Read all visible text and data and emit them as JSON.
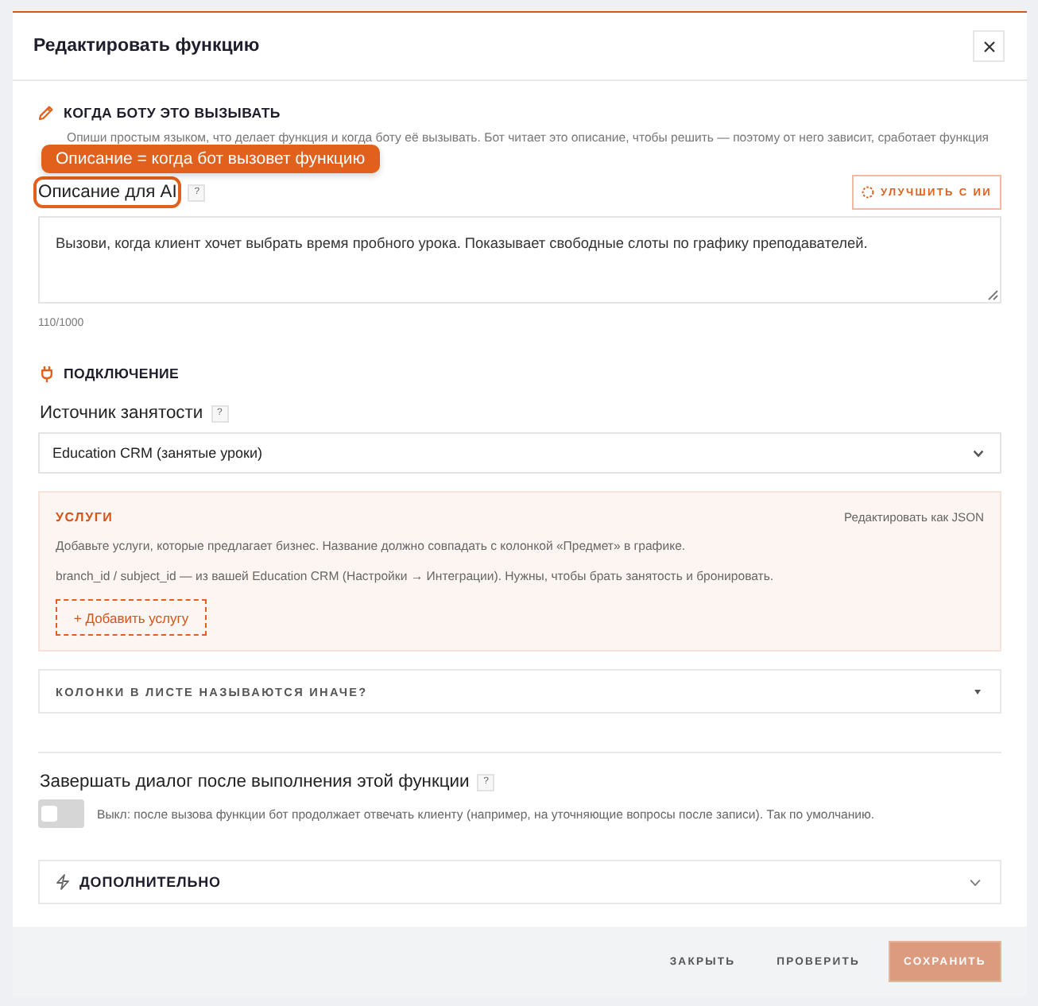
{
  "dialog": {
    "title": "Редактировать функцию"
  },
  "trigger": {
    "heading": "КОГДА БОТУ ЭТО ВЫЗЫВАТЬ",
    "hint": "Опиши простым языком, что делает функция и когда боту её вызывать. Бот читает это описание, чтобы решить — поэтому от него зависит, сработает функция",
    "callout": "Описание = когда бот вызовет функцию",
    "label": "Описание для AI",
    "highlighted": true,
    "help": "?",
    "improve_button": "УЛУЧШИТЬ С ИИ",
    "value": "Вызови, когда клиент хочет выбрать время пробного урока. Показывает свободные слоты по графику преподавателей.",
    "counter": "110/1000"
  },
  "connection": {
    "heading": "ПОДКЛЮЧЕНИЕ",
    "source_label": "Источник занятости",
    "source_help": "?",
    "source_value": "Education CRM (занятые уроки)",
    "services": {
      "title": "УСЛУГИ",
      "edit_json_link": "Редактировать как JSON",
      "notes": [
        "Добавьте услуги, которые предлагает бизнес. Название должно совпадать с колонкой «Предмет» в графике.",
        "branch_id / subject_id — из вашей Education CRM (Настройки → Интеграции). Нужны, чтобы брать занятость и бронировать."
      ],
      "add_button": "+ Добавить услугу"
    },
    "columns": {
      "title": "КОЛОНКИ В ЛИСТЕ НАЗЫВАЮТСЯ ИНАЧЕ?",
      "expanded": false
    }
  },
  "end_dialog": {
    "label": "Завершать диалог после выполнения этой функции",
    "help": "?",
    "on": false,
    "hint": "Выкл: после вызова функции бот продолжает отвечать клиенту (например, на уточняющие вопросы после записи). Так по умолчанию."
  },
  "advanced": {
    "title": "ДОПОЛНИТЕЛЬНО",
    "expanded": false
  },
  "footer": {
    "buttons": [
      {
        "label": "ЗАКРЫТЬ",
        "kind": "text",
        "disabled": false
      },
      {
        "label": "ПРОВЕРИТЬ",
        "kind": "text",
        "disabled": false
      },
      {
        "label": "СОХРАНИТЬ",
        "kind": "primary",
        "disabled": true
      }
    ]
  }
}
